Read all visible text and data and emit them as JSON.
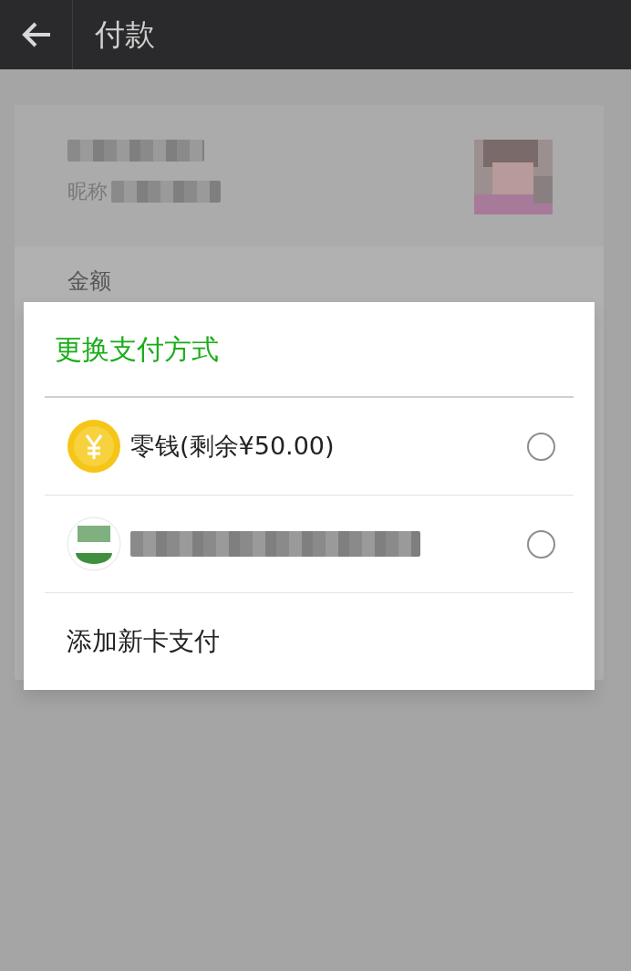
{
  "app_bar": {
    "title": "付款"
  },
  "payee": {
    "nickname_label": "昵称"
  },
  "amount": {
    "label": "金额"
  },
  "dialog": {
    "title": "更换支付方式",
    "options": [
      {
        "kind": "balance",
        "label": "零钱(剩余¥50.00)",
        "selected": false
      },
      {
        "kind": "card",
        "selected": false
      }
    ],
    "add_card": "添加新卡支付"
  }
}
